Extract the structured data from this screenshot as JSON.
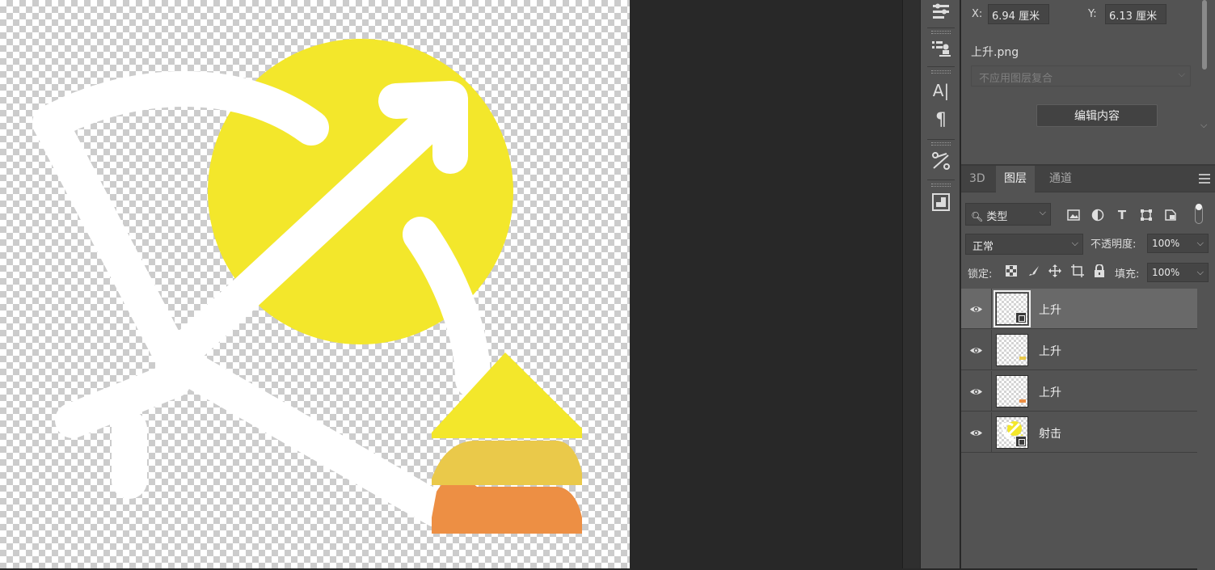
{
  "canvas": {
    "image_colors": {
      "circle": "#f3e72b",
      "arrow_top": "#f3e72b",
      "arrow_mid": "#eac94a",
      "arrow_bottom": "#ed8f44",
      "bow": "#ffffff"
    }
  },
  "toolbar_icons": [
    {
      "name": "properties-adjust-icon",
      "glyph": "≡"
    },
    {
      "name": "layer-comps-icon",
      "glyph": "☰"
    },
    {
      "name": "character-icon",
      "glyph": "A|"
    },
    {
      "name": "paragraph-icon",
      "glyph": "¶"
    },
    {
      "name": "tools-preset-icon",
      "glyph": "✂"
    },
    {
      "name": "navigator-icon",
      "glyph": "▣"
    }
  ],
  "properties": {
    "x_label": "X:",
    "x_value": "6.94 厘米",
    "y_label": "Y:",
    "y_value": "6.13 厘米",
    "file_name": "上升.png",
    "layer_comp_placeholder": "不应用图层复合",
    "edit_button": "编辑内容"
  },
  "layers_panel": {
    "tabs": [
      {
        "label": "3D",
        "active": false
      },
      {
        "label": "图层",
        "active": true
      },
      {
        "label": "通道",
        "active": false
      }
    ],
    "filter": {
      "label": "类型"
    },
    "blend_mode": "正常",
    "opacity_label": "不透明度:",
    "opacity_value": "100%",
    "lock_label": "锁定:",
    "fill_label": "填充:",
    "fill_value": "100%",
    "layers": [
      {
        "name": "上升",
        "visible": true,
        "selected": true,
        "smart_object": true,
        "thumb_color": ""
      },
      {
        "name": "上升",
        "visible": true,
        "selected": false,
        "smart_object": false,
        "thumb_color": "#eac94a"
      },
      {
        "name": "上升",
        "visible": true,
        "selected": false,
        "smart_object": false,
        "thumb_color": "#ed8f44"
      },
      {
        "name": "射击",
        "visible": true,
        "selected": false,
        "smart_object": true,
        "thumb_color": "#f3e72b"
      }
    ]
  }
}
